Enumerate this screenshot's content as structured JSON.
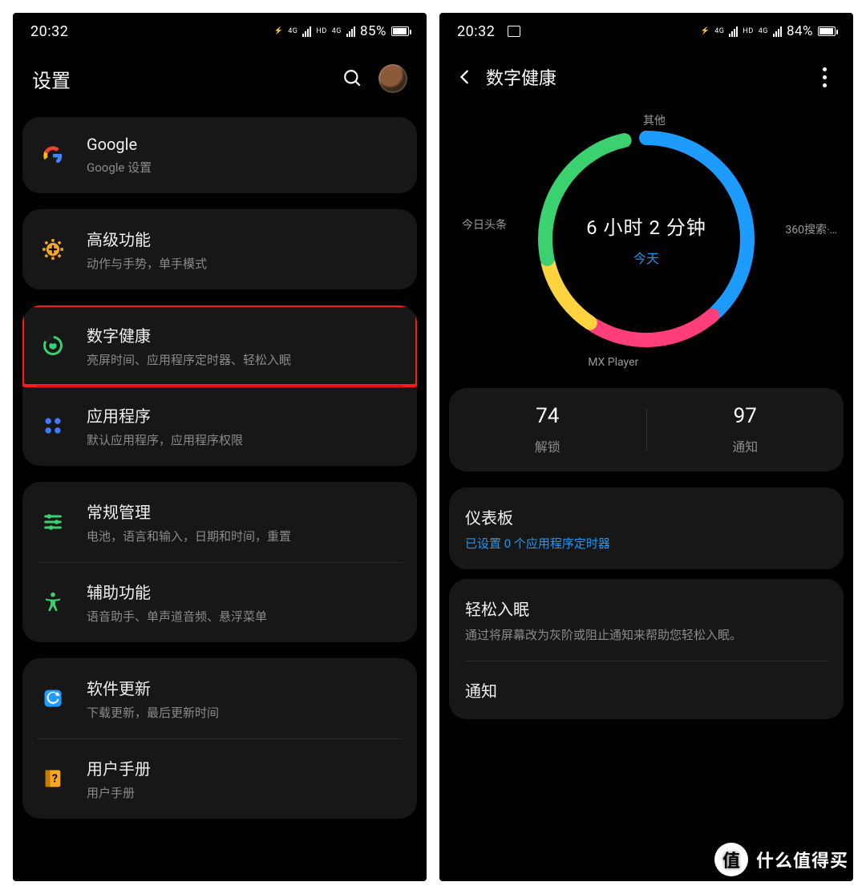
{
  "watermark": {
    "badge": "值",
    "text": "什么值得买"
  },
  "left": {
    "status": {
      "time": "20:32",
      "net1": "4G",
      "net2": "HD",
      "net3": "4G",
      "battery_pct": "85%",
      "battery_fill": 85
    },
    "header": {
      "title": "设置"
    },
    "groups": [
      {
        "rows": [
          {
            "id": "google",
            "icon": "google-icon",
            "title": "Google",
            "sub": "Google 设置"
          }
        ]
      },
      {
        "rows": [
          {
            "id": "advanced",
            "icon": "gear-plus-icon",
            "title": "高级功能",
            "sub": "动作与手势，单手模式"
          }
        ]
      },
      {
        "rows": [
          {
            "id": "digital-wellbeing",
            "icon": "wellbeing-icon",
            "title": "数字健康",
            "sub": "亮屏时间、应用程序定时器、轻松入眠",
            "highlight": true
          },
          {
            "id": "apps",
            "icon": "apps-icon",
            "title": "应用程序",
            "sub": "默认应用程序，应用程序权限"
          }
        ]
      },
      {
        "rows": [
          {
            "id": "general",
            "icon": "sliders-icon",
            "title": "常规管理",
            "sub": "电池，语言和输入，日期和时间，重置"
          },
          {
            "id": "accessibility",
            "icon": "accessibility-icon",
            "title": "辅助功能",
            "sub": "语音助手、单声道音频、悬浮菜单"
          }
        ]
      },
      {
        "rows": [
          {
            "id": "software-update",
            "icon": "update-icon",
            "title": "软件更新",
            "sub": "下载更新，最后更新时间"
          },
          {
            "id": "user-manual",
            "icon": "manual-icon",
            "title": "用户手册",
            "sub": "用户手册"
          }
        ]
      }
    ]
  },
  "right": {
    "status": {
      "time": "20:32",
      "extra_icon": true,
      "net1": "4G",
      "net2": "HD",
      "net3": "4G",
      "battery_pct": "84%",
      "battery_fill": 84
    },
    "header": {
      "title": "数字健康"
    },
    "center": {
      "big": "6 小时 2 分钟",
      "small": "今天"
    },
    "segments_labels": {
      "other": "其他",
      "toutiao": "今日头条",
      "search360": "360搜索·…",
      "mx": "MX Player"
    },
    "stats": [
      {
        "num": "74",
        "lbl": "解锁"
      },
      {
        "num": "97",
        "lbl": "通知"
      }
    ],
    "options": [
      {
        "id": "dashboard",
        "title": "仪表板",
        "sub": "已设置 0 个应用程序定时器",
        "sub_blue": true
      },
      {
        "id": "wind-down",
        "title": "轻松入眠",
        "sub": "通过将屏幕改为灰阶或阻止通知来帮助您轻松入眠。"
      },
      {
        "id": "notifications",
        "title": "通知"
      }
    ]
  },
  "chart_data": {
    "type": "pie",
    "title": "今天",
    "total_label": "6 小时 2 分钟",
    "series": [
      {
        "name": "360搜索·…",
        "value": 150,
        "color": "#1e9bff"
      },
      {
        "name": "MX Player",
        "value": 75,
        "color": "#ff3e7a"
      },
      {
        "name": "今日头条",
        "value": 45,
        "color": "#ffd23f"
      },
      {
        "name": "其他",
        "value": 92,
        "color": "#3bd16f"
      }
    ],
    "unit": "minutes",
    "total_minutes": 362
  }
}
